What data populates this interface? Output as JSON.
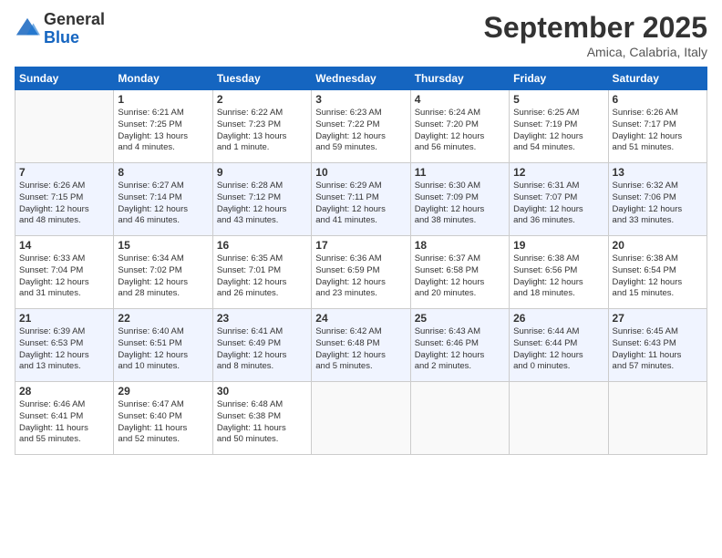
{
  "logo": {
    "general": "General",
    "blue": "Blue"
  },
  "header": {
    "month": "September 2025",
    "location": "Amica, Calabria, Italy"
  },
  "weekdays": [
    "Sunday",
    "Monday",
    "Tuesday",
    "Wednesday",
    "Thursday",
    "Friday",
    "Saturday"
  ],
  "weeks": [
    [
      {
        "day": "",
        "text": ""
      },
      {
        "day": "1",
        "text": "Sunrise: 6:21 AM\nSunset: 7:25 PM\nDaylight: 13 hours\nand 4 minutes."
      },
      {
        "day": "2",
        "text": "Sunrise: 6:22 AM\nSunset: 7:23 PM\nDaylight: 13 hours\nand 1 minute."
      },
      {
        "day": "3",
        "text": "Sunrise: 6:23 AM\nSunset: 7:22 PM\nDaylight: 12 hours\nand 59 minutes."
      },
      {
        "day": "4",
        "text": "Sunrise: 6:24 AM\nSunset: 7:20 PM\nDaylight: 12 hours\nand 56 minutes."
      },
      {
        "day": "5",
        "text": "Sunrise: 6:25 AM\nSunset: 7:19 PM\nDaylight: 12 hours\nand 54 minutes."
      },
      {
        "day": "6",
        "text": "Sunrise: 6:26 AM\nSunset: 7:17 PM\nDaylight: 12 hours\nand 51 minutes."
      }
    ],
    [
      {
        "day": "7",
        "text": "Sunrise: 6:26 AM\nSunset: 7:15 PM\nDaylight: 12 hours\nand 48 minutes."
      },
      {
        "day": "8",
        "text": "Sunrise: 6:27 AM\nSunset: 7:14 PM\nDaylight: 12 hours\nand 46 minutes."
      },
      {
        "day": "9",
        "text": "Sunrise: 6:28 AM\nSunset: 7:12 PM\nDaylight: 12 hours\nand 43 minutes."
      },
      {
        "day": "10",
        "text": "Sunrise: 6:29 AM\nSunset: 7:11 PM\nDaylight: 12 hours\nand 41 minutes."
      },
      {
        "day": "11",
        "text": "Sunrise: 6:30 AM\nSunset: 7:09 PM\nDaylight: 12 hours\nand 38 minutes."
      },
      {
        "day": "12",
        "text": "Sunrise: 6:31 AM\nSunset: 7:07 PM\nDaylight: 12 hours\nand 36 minutes."
      },
      {
        "day": "13",
        "text": "Sunrise: 6:32 AM\nSunset: 7:06 PM\nDaylight: 12 hours\nand 33 minutes."
      }
    ],
    [
      {
        "day": "14",
        "text": "Sunrise: 6:33 AM\nSunset: 7:04 PM\nDaylight: 12 hours\nand 31 minutes."
      },
      {
        "day": "15",
        "text": "Sunrise: 6:34 AM\nSunset: 7:02 PM\nDaylight: 12 hours\nand 28 minutes."
      },
      {
        "day": "16",
        "text": "Sunrise: 6:35 AM\nSunset: 7:01 PM\nDaylight: 12 hours\nand 26 minutes."
      },
      {
        "day": "17",
        "text": "Sunrise: 6:36 AM\nSunset: 6:59 PM\nDaylight: 12 hours\nand 23 minutes."
      },
      {
        "day": "18",
        "text": "Sunrise: 6:37 AM\nSunset: 6:58 PM\nDaylight: 12 hours\nand 20 minutes."
      },
      {
        "day": "19",
        "text": "Sunrise: 6:38 AM\nSunset: 6:56 PM\nDaylight: 12 hours\nand 18 minutes."
      },
      {
        "day": "20",
        "text": "Sunrise: 6:38 AM\nSunset: 6:54 PM\nDaylight: 12 hours\nand 15 minutes."
      }
    ],
    [
      {
        "day": "21",
        "text": "Sunrise: 6:39 AM\nSunset: 6:53 PM\nDaylight: 12 hours\nand 13 minutes."
      },
      {
        "day": "22",
        "text": "Sunrise: 6:40 AM\nSunset: 6:51 PM\nDaylight: 12 hours\nand 10 minutes."
      },
      {
        "day": "23",
        "text": "Sunrise: 6:41 AM\nSunset: 6:49 PM\nDaylight: 12 hours\nand 8 minutes."
      },
      {
        "day": "24",
        "text": "Sunrise: 6:42 AM\nSunset: 6:48 PM\nDaylight: 12 hours\nand 5 minutes."
      },
      {
        "day": "25",
        "text": "Sunrise: 6:43 AM\nSunset: 6:46 PM\nDaylight: 12 hours\nand 2 minutes."
      },
      {
        "day": "26",
        "text": "Sunrise: 6:44 AM\nSunset: 6:44 PM\nDaylight: 12 hours\nand 0 minutes."
      },
      {
        "day": "27",
        "text": "Sunrise: 6:45 AM\nSunset: 6:43 PM\nDaylight: 11 hours\nand 57 minutes."
      }
    ],
    [
      {
        "day": "28",
        "text": "Sunrise: 6:46 AM\nSunset: 6:41 PM\nDaylight: 11 hours\nand 55 minutes."
      },
      {
        "day": "29",
        "text": "Sunrise: 6:47 AM\nSunset: 6:40 PM\nDaylight: 11 hours\nand 52 minutes."
      },
      {
        "day": "30",
        "text": "Sunrise: 6:48 AM\nSunset: 6:38 PM\nDaylight: 11 hours\nand 50 minutes."
      },
      {
        "day": "",
        "text": ""
      },
      {
        "day": "",
        "text": ""
      },
      {
        "day": "",
        "text": ""
      },
      {
        "day": "",
        "text": ""
      }
    ]
  ]
}
